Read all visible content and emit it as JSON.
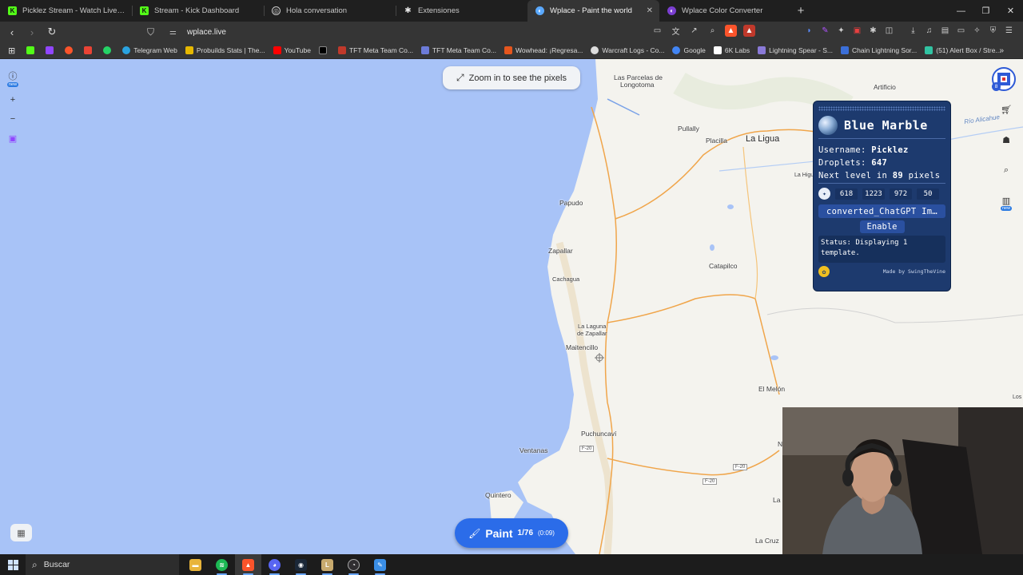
{
  "tabs": [
    {
      "title": "Picklez Stream - Watch Live on Kick",
      "icon": "kick-icon",
      "color": "#53fc18",
      "active": false
    },
    {
      "title": "Stream - Kick Dashboard",
      "icon": "kick-icon",
      "color": "#53fc18",
      "active": false
    },
    {
      "title": "Hola conversation",
      "icon": "chatgpt-icon",
      "color": "#cccccc",
      "active": false
    },
    {
      "title": "Extensiones",
      "icon": "puzzle-icon",
      "color": "#e8e8e8",
      "active": false
    },
    {
      "title": "Wplace - Paint the world",
      "icon": "globe-icon",
      "color": "#5aa9ff",
      "active": true
    },
    {
      "title": "Wplace Color Converter",
      "icon": "globe-icon",
      "color": "#7b3fd1",
      "active": false
    }
  ],
  "new_tab_label": "+",
  "address": {
    "url": "wplace.live"
  },
  "bookmarks": [
    {
      "label": "",
      "icon": "kick-bookmark-icon",
      "color": "#53fc18"
    },
    {
      "label": "",
      "icon": "twitch-bookmark-icon",
      "color": "#9146ff"
    },
    {
      "label": "",
      "icon": "brave-bookmark-icon",
      "color": "#fb542b"
    },
    {
      "label": "",
      "icon": "gmail-bookmark-icon",
      "color": "#ea4335"
    },
    {
      "label": "",
      "icon": "whatsapp-bookmark-icon",
      "color": "#25d366"
    },
    {
      "label": "Telegram Web",
      "icon": "telegram-icon",
      "color": "#2aa3e0"
    },
    {
      "label": "Probuilds Stats | The...",
      "icon": "probuilds-icon",
      "color": "#e6b800"
    },
    {
      "label": "YouTube",
      "icon": "youtube-icon",
      "color": "#ff0000"
    },
    {
      "label": "",
      "icon": "x-icon",
      "color": "#eeeeee"
    },
    {
      "label": "TFT Meta Team Co...",
      "icon": "tft-icon",
      "color": "#c0392b"
    },
    {
      "label": "TFT Meta Team Co...",
      "icon": "tft-icon",
      "color": "#6c7bd8"
    },
    {
      "label": "Wowhead: ¡Regresa...",
      "icon": "wowhead-icon",
      "color": "#e5561e"
    },
    {
      "label": "Warcraft Logs - Co...",
      "icon": "warcraftlogs-icon",
      "color": "#dddddd"
    },
    {
      "label": "Google",
      "icon": "google-icon",
      "color": "#4285f4"
    },
    {
      "label": "6K Labs",
      "icon": "6klabs-icon",
      "color": "#ffffff"
    },
    {
      "label": "Lightning Spear - S...",
      "icon": "spear-icon",
      "color": "#8a7ad8"
    },
    {
      "label": "Chain Lightning Sor...",
      "icon": "chain-icon",
      "color": "#3b6fd8"
    },
    {
      "label": "(51) Alert Box / Stre...",
      "icon": "alertbox-icon",
      "color": "#31c3a2"
    }
  ],
  "map": {
    "zoom_hint": "Zoom in to see the pixels",
    "places": [
      {
        "name": "Las Parcelas de",
        "cls": ""
      },
      {
        "name": "Longotoma",
        "cls": ""
      },
      {
        "name": "Artificio",
        "cls": ""
      },
      {
        "name": "Pullally",
        "cls": ""
      },
      {
        "name": "Placilla",
        "cls": ""
      },
      {
        "name": "La Ligua",
        "cls": "big"
      },
      {
        "name": "Río Alicahue",
        "cls": "water"
      },
      {
        "name": "La Higu",
        "cls": ""
      },
      {
        "name": "Papudo",
        "cls": ""
      },
      {
        "name": "Zapallar",
        "cls": ""
      },
      {
        "name": "Cachagua",
        "cls": ""
      },
      {
        "name": "Catapilco",
        "cls": ""
      },
      {
        "name": "La Laguna",
        "cls": ""
      },
      {
        "name": "de Zapallar",
        "cls": ""
      },
      {
        "name": "Maitencillo",
        "cls": ""
      },
      {
        "name": "El Melón",
        "cls": ""
      },
      {
        "name": "Los",
        "cls": ""
      },
      {
        "name": "Puchuncaví",
        "cls": ""
      },
      {
        "name": "F-20",
        "cls": "road"
      },
      {
        "name": "Ventanas",
        "cls": ""
      },
      {
        "name": "F-20",
        "cls": "road"
      },
      {
        "name": "F-20",
        "cls": "road"
      },
      {
        "name": "N",
        "cls": ""
      },
      {
        "name": "Quintero",
        "cls": ""
      },
      {
        "name": "La",
        "cls": ""
      },
      {
        "name": "La Cruz",
        "cls": ""
      }
    ],
    "left_badge": "new",
    "right_badge": "new",
    "avatar_level": "8"
  },
  "blue_marble": {
    "title": "Blue Marble",
    "username_label": "Username:",
    "username": "Picklez",
    "droplets_label": "Droplets:",
    "droplets": "647",
    "next_level_prefix": "Next level in",
    "next_level_pixels": "89",
    "next_level_suffix": "pixels",
    "coords": [
      "618",
      "1223",
      "972",
      "50"
    ],
    "file_name": "converted_ChatGPT Im…",
    "enable_label": "Enable",
    "status": "Status: Displaying 1 template.",
    "made_by": "Made by SwingTheVine"
  },
  "paint": {
    "label": "Paint",
    "count": "1/76",
    "timer": "(0:09)"
  },
  "taskbar": {
    "search_placeholder": "Buscar"
  },
  "colors": {
    "ocean": "#a8c3f7",
    "land": "#f4f3ee",
    "panel": "#1d3a6e",
    "paint": "#2b6ce9"
  }
}
